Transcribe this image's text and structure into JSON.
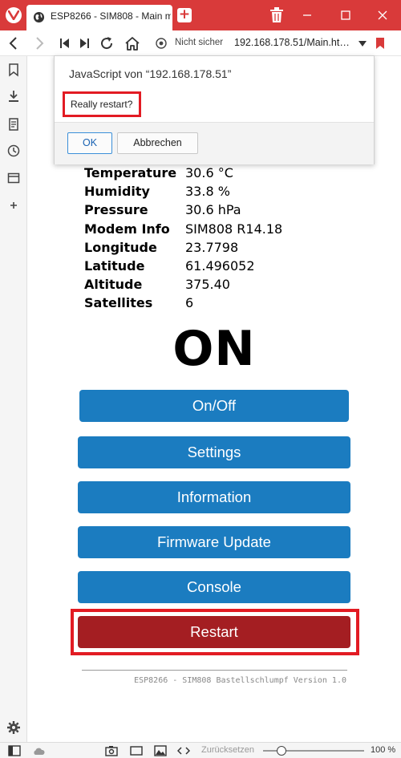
{
  "browser": {
    "tab_title": "ESP8266 - SIM808 - Main me",
    "security_label": "Nicht sicher",
    "url": "192.168.178.51/Main.ht…",
    "accent_color": "#d93a3a"
  },
  "dialog": {
    "title": "JavaScript von “192.168.178.51”",
    "message": "Really restart?",
    "ok_label": "OK",
    "cancel_label": "Abbrechen"
  },
  "sensors": [
    {
      "label": "Temperature",
      "value": "30.6 °C"
    },
    {
      "label": "Humidity",
      "value": "33.8 %"
    },
    {
      "label": "Pressure",
      "value": "30.6 hPa"
    },
    {
      "label": "Modem Info",
      "value": "SIM808 R14.18"
    },
    {
      "label": "Longitude",
      "value": "23.7798"
    },
    {
      "label": "Latitude",
      "value": "61.496052"
    },
    {
      "label": "Altitude",
      "value": "375.40"
    },
    {
      "label": "Satellites",
      "value": "6"
    }
  ],
  "state": "ON",
  "buttons": {
    "onoff": "On/Off",
    "settings": "Settings",
    "information": "Information",
    "firmware": "Firmware Update",
    "console": "Console",
    "restart": "Restart"
  },
  "colors": {
    "primary_button": "#1b7cc0",
    "restart_button": "#a41e22",
    "highlight": "#e21b23"
  },
  "footer": "ESP8266 - SIM808 Bastellschlumpf Version 1.0",
  "statusbar": {
    "zoom_reset_label": "Zurücksetzen",
    "zoom_level": "100 %",
    "zoom_fraction": 0.15
  }
}
